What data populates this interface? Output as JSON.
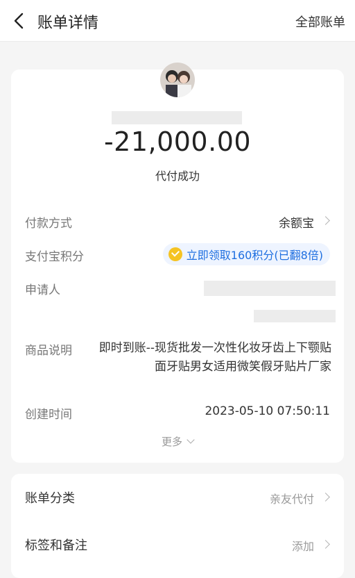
{
  "header": {
    "title": "账单详情",
    "right_action": "全部账单"
  },
  "summary": {
    "amount": "-21,000.00",
    "status": "代付成功"
  },
  "details": {
    "payment_method_label": "付款方式",
    "payment_method_value": "余额宝",
    "points_label": "支付宝积分",
    "points_value": "立即领取160积分(已翻8倍)",
    "applicant_label": "申请人",
    "description_label": "商品说明",
    "description_value": "即时到账--现货批发一次性化妆牙齿上下颚贴面牙贴男女适用微笑假牙贴片厂家",
    "created_label": "创建时间",
    "created_value": "2023-05-10 07:50:11",
    "more_label": "更多"
  },
  "extra": {
    "category_label": "账单分类",
    "category_value": "亲友代付",
    "tags_label": "标签和备注",
    "tags_value": "添加"
  },
  "colors": {
    "link_blue": "#1f6fe0",
    "coin_gold": "#f5c323",
    "background": "#f5f5f5"
  }
}
